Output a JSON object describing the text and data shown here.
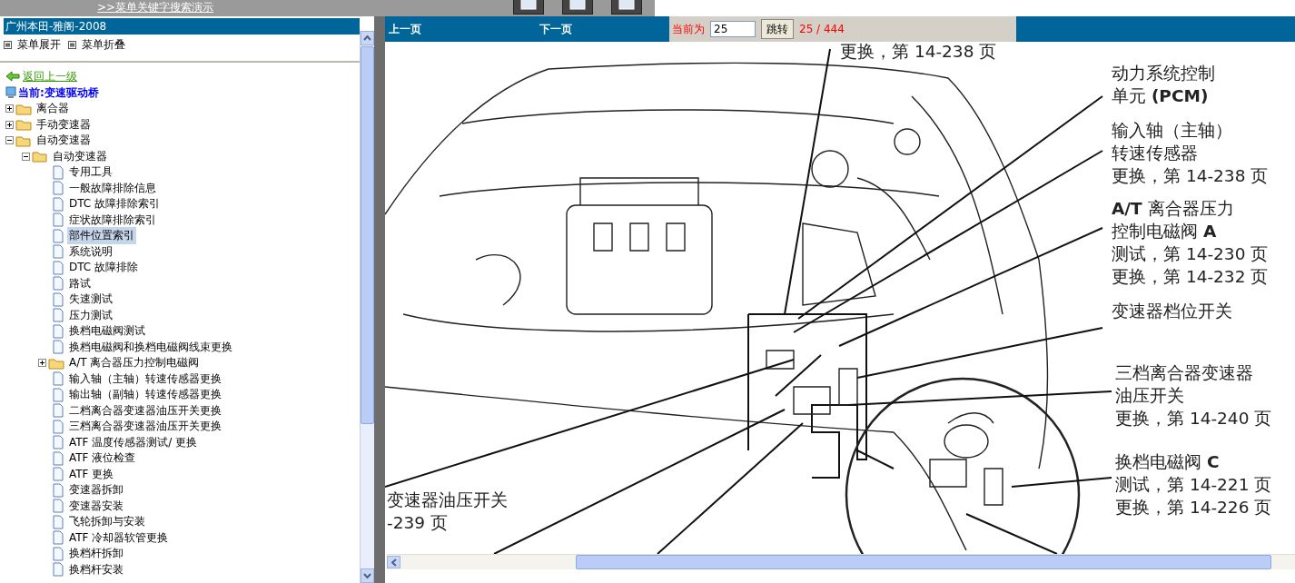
{
  "top_bar": {
    "link": ">>菜单关键字搜索演示"
  },
  "sidebar": {
    "title": "广州本田-雅阁-2008",
    "actions": [
      "菜单展开",
      "菜单折叠"
    ],
    "back_link": "返回上一级",
    "current": "当前:变速驱动桥",
    "tree": [
      {
        "kind": "folder",
        "label": "离合器",
        "expanded": false,
        "selected": false
      },
      {
        "kind": "folder",
        "label": "手动变速器",
        "expanded": false,
        "selected": false
      },
      {
        "kind": "folder",
        "label": "自动变速器",
        "expanded": true,
        "selected": false,
        "children": [
          {
            "kind": "folder",
            "label": "自动变速器",
            "expanded": true,
            "selected": false,
            "children": [
              {
                "kind": "page",
                "label": "专用工具",
                "selected": false
              },
              {
                "kind": "page",
                "label": "一般故障排除信息",
                "selected": false
              },
              {
                "kind": "page",
                "label": "DTC 故障排除索引",
                "selected": false
              },
              {
                "kind": "page",
                "label": "症状故障排除索引",
                "selected": false
              },
              {
                "kind": "page",
                "label": "部件位置索引",
                "selected": true
              },
              {
                "kind": "page",
                "label": "系统说明",
                "selected": false
              },
              {
                "kind": "page",
                "label": "DTC 故障排除",
                "selected": false
              },
              {
                "kind": "page",
                "label": "路试",
                "selected": false
              },
              {
                "kind": "page",
                "label": "失速测试",
                "selected": false
              },
              {
                "kind": "page",
                "label": "压力测试",
                "selected": false
              },
              {
                "kind": "page",
                "label": "换档电磁阀测试",
                "selected": false
              },
              {
                "kind": "page",
                "label": "换档电磁阀和换档电磁阀线束更换",
                "selected": false
              },
              {
                "kind": "folder",
                "label": "A/T 离合器压力控制电磁阀",
                "expanded": false,
                "selected": false
              },
              {
                "kind": "page",
                "label": "输入轴（主轴）转速传感器更换",
                "selected": false
              },
              {
                "kind": "page",
                "label": "输出轴（副轴）转速传感器更换",
                "selected": false
              },
              {
                "kind": "page",
                "label": "二档离合器变速器油压开关更换",
                "selected": false
              },
              {
                "kind": "page",
                "label": "三档离合器变速器油压开关更换",
                "selected": false
              },
              {
                "kind": "page",
                "label": "ATF 温度传感器测试/ 更换",
                "selected": false
              },
              {
                "kind": "page",
                "label": "ATF 液位检查",
                "selected": false
              },
              {
                "kind": "page",
                "label": "ATF 更换",
                "selected": false
              },
              {
                "kind": "page",
                "label": "变速器拆卸",
                "selected": false
              },
              {
                "kind": "page",
                "label": "变速器安装",
                "selected": false
              },
              {
                "kind": "page",
                "label": "飞轮拆卸与安装",
                "selected": false
              },
              {
                "kind": "page",
                "label": "ATF 冷却器软管更换",
                "selected": false
              },
              {
                "kind": "page",
                "label": "换档杆拆卸",
                "selected": false
              },
              {
                "kind": "page",
                "label": "换档杆安装",
                "selected": false
              }
            ]
          }
        ]
      }
    ]
  },
  "viewer": {
    "prev": "上一页",
    "next": "下一页",
    "page_label": "当前为",
    "page_value": "25",
    "go_button": "跳转",
    "page_count": "25 / 444",
    "callouts": [
      {
        "lines": [
          "更换，第 14-238 页"
        ]
      },
      {
        "lines": [
          "动力系统控制",
          "单元 **(PCM)**"
        ]
      },
      {
        "lines": [
          "输入轴（主轴）",
          "转速传感器",
          "更换，第 14-238 页"
        ]
      },
      {
        "lines": [
          "**A/T** 离合器压力",
          "控制电磁阀 **A**",
          "测试，第 14-230 页",
          "更换，第 14-232 页"
        ]
      },
      {
        "lines": [
          "变速器档位开关"
        ]
      },
      {
        "lines": [
          "三档离合器变速器",
          "油压开关",
          "更换，第 14-240 页"
        ]
      },
      {
        "lines": [
          "换档电磁阀 **C**",
          "测试，第 14-221 页",
          "更换，第 14-226 页"
        ]
      },
      {
        "lines": [
          "变速器油压开关",
          "-239 页"
        ]
      }
    ]
  }
}
